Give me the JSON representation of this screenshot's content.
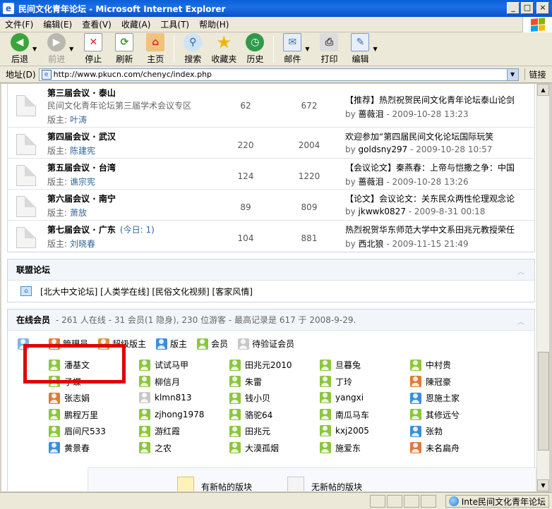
{
  "window": {
    "title": "民间文化青年论坛 - Microsoft Internet Explorer"
  },
  "menu": [
    "文件(F)",
    "编辑(E)",
    "查看(V)",
    "收藏(A)",
    "工具(T)",
    "帮助(H)"
  ],
  "toolbar": {
    "back": "后退",
    "forward": "前进",
    "stop": "停止",
    "refresh": "刷新",
    "home": "主页",
    "search": "搜索",
    "favorites": "收藏夹",
    "history": "历史",
    "mail": "邮件",
    "print": "打印",
    "edit": "编辑"
  },
  "address": {
    "label": "地址(D)",
    "url": "http://www.pkucn.com/chenyc/index.php",
    "go": "链接"
  },
  "forums": [
    {
      "name": "第三届会议 · 泰山",
      "desc": "民间文化青年论坛第三届学术会议专区",
      "mod_label": "版主:",
      "mod": "叶涛",
      "today": "",
      "threads": "62",
      "posts": "672",
      "last_title": "【推荐】热烈祝贺民间文化青年论坛泰山论剑",
      "by": "by",
      "last_user": "蔷薇泪",
      "last_time": " - 2009-10-28 13:23"
    },
    {
      "name": "第四届会议 · 武汉",
      "desc": "",
      "mod_label": "版主:",
      "mod": "陈建宪",
      "today": "",
      "threads": "220",
      "posts": "2004",
      "last_title": "欢迎参加“第四届民间文化论坛国际玩笑",
      "by": "by",
      "last_user": "goldsny297",
      "last_time": " - 2009-10-28 10:57"
    },
    {
      "name": "第五届会议 · 台湾",
      "desc": "",
      "mod_label": "版主:",
      "mod": "谯宗宪",
      "today": "",
      "threads": "124",
      "posts": "1220",
      "last_title": "【会议论文】秦燕春：上帝与恺撒之争：中国",
      "by": "by",
      "last_user": "蔷薇泪",
      "last_time": " - 2009-10-28 13:26"
    },
    {
      "name": "第六届会议 · 南宁",
      "desc": "",
      "mod_label": "版主:",
      "mod": "萧放",
      "today": "",
      "threads": "89",
      "posts": "809",
      "last_title": "【论文】会议论文：关东民众两性伦理观念论",
      "by": "by",
      "last_user": "jkwwk0827",
      "last_time": " - 2009-8-31 00:18"
    },
    {
      "name": "第七届会议 · 广东",
      "desc": "",
      "mod_label": "版主:",
      "mod": "刘晓春",
      "today": "(今日: 1)",
      "threads": "104",
      "posts": "881",
      "last_title": "热烈祝贺华东师范大学中文系田兆元教授荣任",
      "by": "by",
      "last_user": "西北狼",
      "last_time": " - 2009-11-15 21:49"
    }
  ],
  "union": {
    "title": "联盟论坛",
    "links": "[北大中文论坛] [人类学在线] [民俗文化视频] [客家风情]"
  },
  "online": {
    "title": "在线会员",
    "summary": "- 261 人在线 - 31 会员(1 隐身), 230 位游客 - 最高记录是 617 于 2008-9-29.",
    "legend": [
      {
        "label": "管理员",
        "color": "#e07a3a"
      },
      {
        "label": "超级版主",
        "color": "#e0923a"
      },
      {
        "label": "版主",
        "color": "#3a8fd9"
      },
      {
        "label": "会员",
        "color": "#8cc63f"
      },
      {
        "label": "待验证会员",
        "color": "#c8c8c8"
      }
    ],
    "members": [
      [
        "潘基文",
        "试试马甲",
        "田兆元2010",
        "旦暮兔",
        "中村贵"
      ],
      [
        "子蝶",
        "柳信月",
        "朱雷",
        "丁玲",
        "陳冠豪"
      ],
      [
        "张志娟",
        "klmn813",
        "钱小贝",
        "yangxi",
        "恩施土家"
      ],
      [
        "鹏程万里",
        "zjhong1978",
        "骆驼64",
        "南瓜马车",
        "其修远兮"
      ],
      [
        "眉间尺533",
        "游红霞",
        "田兆元",
        "kxj2005",
        "张勃"
      ],
      [
        "黄景春",
        "之农",
        "大漠孤烟",
        "施爱东",
        "未名扁舟"
      ]
    ],
    "member_colors": [
      [
        "#8cc63f",
        "#8cc63f",
        "#8cc63f",
        "#8cc63f",
        "#8cc63f"
      ],
      [
        "#8cc63f",
        "#8cc63f",
        "#8cc63f",
        "#8cc63f",
        "#e07a3a"
      ],
      [
        "#e07a3a",
        "#c8c8c8",
        "#8cc63f",
        "#8cc63f",
        "#3a8fd9"
      ],
      [
        "#8cc63f",
        "#8cc63f",
        "#8cc63f",
        "#8cc63f",
        "#8cc63f"
      ],
      [
        "#8cc63f",
        "#8cc63f",
        "#8cc63f",
        "#8cc63f",
        "#3a8fd9"
      ],
      [
        "#3a8fd9",
        "#8cc63f",
        "#8cc63f",
        "#8cc63f",
        "#e07a3a"
      ]
    ]
  },
  "legend_bottom": {
    "new": "有新帖的版块",
    "nonew": "无新帖的版块"
  },
  "status": {
    "zone": "Inte民间文化青年论坛"
  }
}
